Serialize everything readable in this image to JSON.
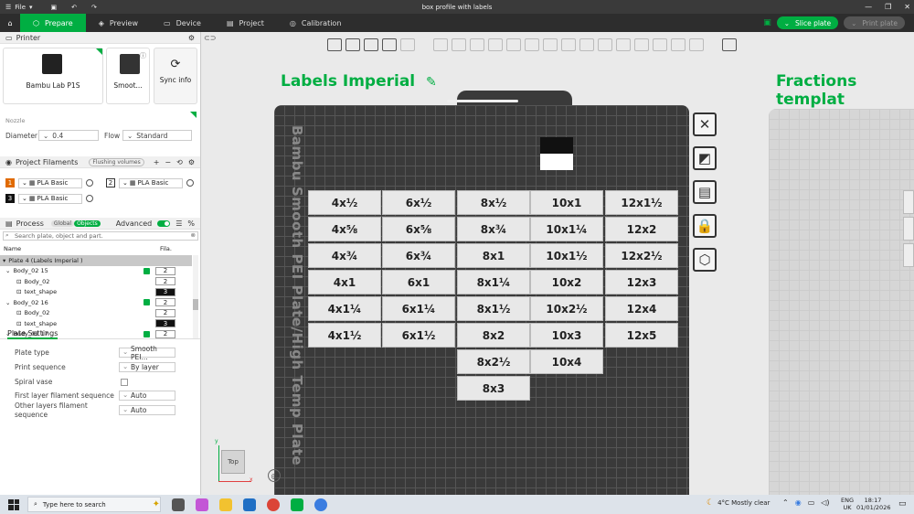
{
  "window": {
    "title": "box profile with labels",
    "file_menu": "File"
  },
  "tabs": [
    {
      "label": "Prepare",
      "icon": "cube-icon"
    },
    {
      "label": "Preview",
      "icon": "layers-icon"
    },
    {
      "label": "Device",
      "icon": "device-icon"
    },
    {
      "label": "Project",
      "icon": "project-icon"
    },
    {
      "label": "Calibration",
      "icon": "calibration-icon"
    }
  ],
  "actions": {
    "slice": "Slice plate",
    "print": "Print plate"
  },
  "printer": {
    "section": "Printer",
    "model": "Bambu Lab P1S",
    "plate_type": "Smoot...",
    "sync": "Sync info",
    "nozzle_label": "Nozzle",
    "diameter_label": "Diameter",
    "diameter_value": "0.4",
    "flow_label": "Flow",
    "flow_value": "Standard"
  },
  "filaments": {
    "section": "Project Filaments",
    "flushing": "Flushing volumes",
    "items": [
      {
        "num": "1",
        "name": "PLA Basic",
        "color": "#e06a00"
      },
      {
        "num": "2",
        "name": "PLA Basic",
        "color": "#ffffff"
      },
      {
        "num": "3",
        "name": "PLA Basic",
        "color": "#111111"
      }
    ]
  },
  "process": {
    "section": "Process",
    "global": "Global",
    "objects": "Objects",
    "advanced": "Advanced",
    "search_placeholder": "Search plate, object and part.",
    "col_name": "Name",
    "col_fila": "Fila.",
    "rows": [
      {
        "name": "Plate 4 (Labels Imperial )",
        "level": 0,
        "fila": "",
        "check": false,
        "plate": true
      },
      {
        "name": "Body_02 15",
        "level": 1,
        "fila": "2",
        "check": true
      },
      {
        "name": "Body_02",
        "level": 2,
        "fila": "2",
        "check": false
      },
      {
        "name": "text_shape",
        "level": 2,
        "fila": "3",
        "check": false,
        "dark": true
      },
      {
        "name": "Body_02 16",
        "level": 1,
        "fila": "2",
        "check": true
      },
      {
        "name": "Body_02",
        "level": 2,
        "fila": "2",
        "check": false
      },
      {
        "name": "text_shape",
        "level": 2,
        "fila": "3",
        "check": false,
        "dark": true
      },
      {
        "name": "Body_02 17",
        "level": 1,
        "fila": "2",
        "check": true
      }
    ]
  },
  "plate_settings": {
    "tab": "Plate Settings",
    "rows": [
      {
        "label": "Plate type",
        "value": "Smooth PEI..."
      },
      {
        "label": "Print sequence",
        "value": "By layer"
      },
      {
        "label": "Spiral vase",
        "value": ""
      },
      {
        "label": "First layer filament sequence",
        "value": "Auto"
      },
      {
        "label": "Other layers filament sequence",
        "value": "Auto"
      }
    ]
  },
  "canvas": {
    "plate_name": "Labels Imperial",
    "next_plate_name": "Fractions templat",
    "plate_side_text": "Bambu Smooth PEI Plate/High Temp Plate",
    "view_label": "Top",
    "labels": [
      [
        "4x½",
        "4x⅝",
        "4x¾",
        "4x1",
        "4x1¼",
        "4x1½"
      ],
      [
        "6x½",
        "6x⅝",
        "6x¾",
        "6x1",
        "6x1¼",
        "6x1½"
      ],
      [
        "8x½",
        "8x¾",
        "8x1",
        "8x1¼",
        "8x1½",
        "8x2",
        "8x2½",
        "8x3"
      ],
      [
        "10x1",
        "10x1¼",
        "10x1½",
        "10x2",
        "10x2½",
        "10x3",
        "10x4"
      ],
      [
        "12x1½",
        "12x2",
        "12x2½",
        "12x3",
        "12x4",
        "12x5"
      ]
    ]
  },
  "taskbar": {
    "search": "Type here to search",
    "weather": "4°C  Mostly clear",
    "lang1": "ENG",
    "lang2": "UK",
    "time": "18:17",
    "date": "01/01/2026"
  }
}
